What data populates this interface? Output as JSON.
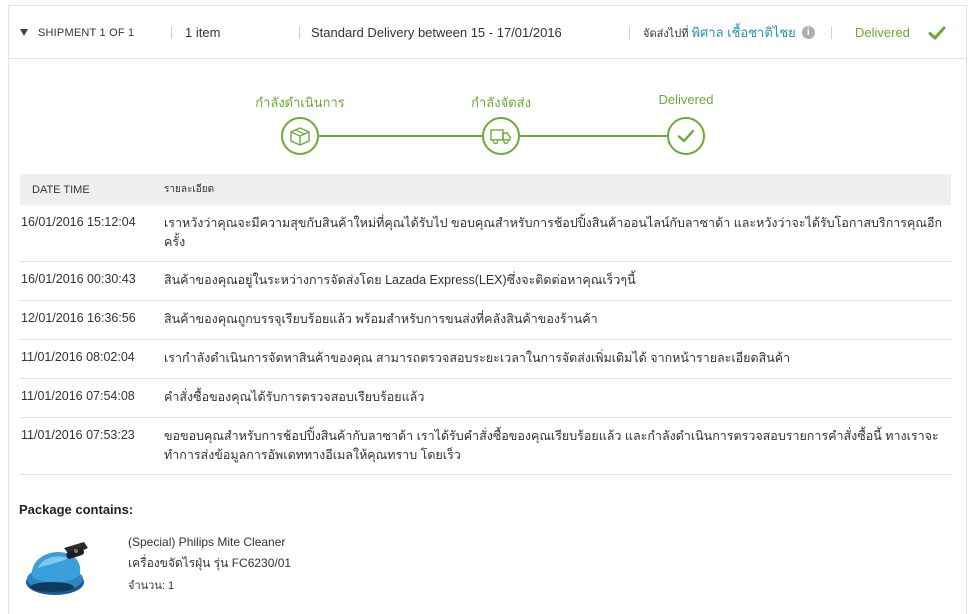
{
  "header": {
    "shipment_label": "SHIPMENT 1 OF 1",
    "items_count": "1 item",
    "delivery_window": "Standard Delivery between 15 - 17/01/2016",
    "ship_to_label": "จัดส่งไปที่",
    "recipient_name": "พิศาล เชื้อชาติไชย",
    "info_icon": "i",
    "status": "Delivered"
  },
  "progress": {
    "steps": [
      {
        "label": "กำลังดำเนินการ",
        "icon": "box-icon"
      },
      {
        "label": "กำลังจัดส่ง",
        "icon": "truck-icon"
      },
      {
        "label": "Delivered",
        "icon": "check-icon"
      }
    ]
  },
  "table": {
    "headers": [
      "DATE TIME",
      "รายละเอียด"
    ],
    "rows": [
      {
        "datetime": "16/01/2016 15:12:04",
        "detail": "เราหวังว่าคุณจะมีความสุขกับสินค้าใหม่ที่คุณได้รับไป ขอบคุณสำหรับการช้อปปิ้งสินค้าออนไลน์กับลาซาด้า และหวังว่าจะได้รับโอกาสบริการคุณอีกครั้ง"
      },
      {
        "datetime": "16/01/2016 00:30:43",
        "detail": "สินค้าของคุณอยู่ในระหว่างการจัดส่งโดย Lazada Express(LEX)ซึ่งจะติดต่อหาคุณเร็วๆนี้"
      },
      {
        "datetime": "12/01/2016 16:36:56",
        "detail": "สินค้าของคุณถูกบรรจุเรียบร้อยแล้ว พร้อมสำหรับการขนส่งที่คลังสินค้าของร้านค้า"
      },
      {
        "datetime": "11/01/2016 08:02:04",
        "detail": "เรากำลังดำเนินการจัดหาสินค้าของคุณ สามารถตรวจสอบระยะเวลาในการจัดส่งเพิ่มเติมได้ จากหน้ารายละเอียดสินค้า"
      },
      {
        "datetime": "11/01/2016 07:54:08",
        "detail": "คำสั่งซื้อของคุณได้รับการตรวจสอบเรียบร้อยแล้ว"
      },
      {
        "datetime": "11/01/2016 07:53:23",
        "detail": "ขอขอบคุณสำหรับการช้อปปิ้งสินค้ากับลาซาด้า เราได้รับคำสั่งซื้อของคุณเรียบร้อยแล้ว และกำลังดำเนินการตรวจสอบรายการคำสั่งซื้อนี้ ทางเราจะทำการส่งข้อมูลการอัพเดททางอีเมลให้คุณทราบ โดยเร็ว"
      }
    ]
  },
  "package": {
    "title": "Package contains:",
    "product_name": "(Special) Philips Mite Cleaner",
    "product_desc": "เครื่องขจัดไรฝุ่น รุ่น FC6230/01",
    "quantity": "จำนวน: 1"
  },
  "colors": {
    "accent_green": "#6aab35",
    "link_blue": "#2b8fb8",
    "header_gray": "#efefef"
  }
}
